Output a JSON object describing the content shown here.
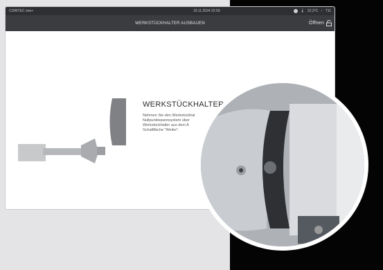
{
  "status": {
    "brand": "CORITEC one+",
    "datetime": "19.11.2024 22:59",
    "temperature": "22,3°C",
    "counter": "T11"
  },
  "header": {
    "title": "WERKSTÜCKHALTER AUSBAUEN",
    "open_label": "Öffnen"
  },
  "main": {
    "heading": "WERKSTÜCKHALTER AUS",
    "instructions": "Nehmen Sie den Werkstückhal\nNullpunktspannsystem über\nWerkstückhalter aus dem A\nSchaltfläche \"Weiter\"."
  },
  "icons": {
    "status_dot": "network-icon",
    "thermometer": "thermometer-icon",
    "lock": "unlock-icon"
  }
}
